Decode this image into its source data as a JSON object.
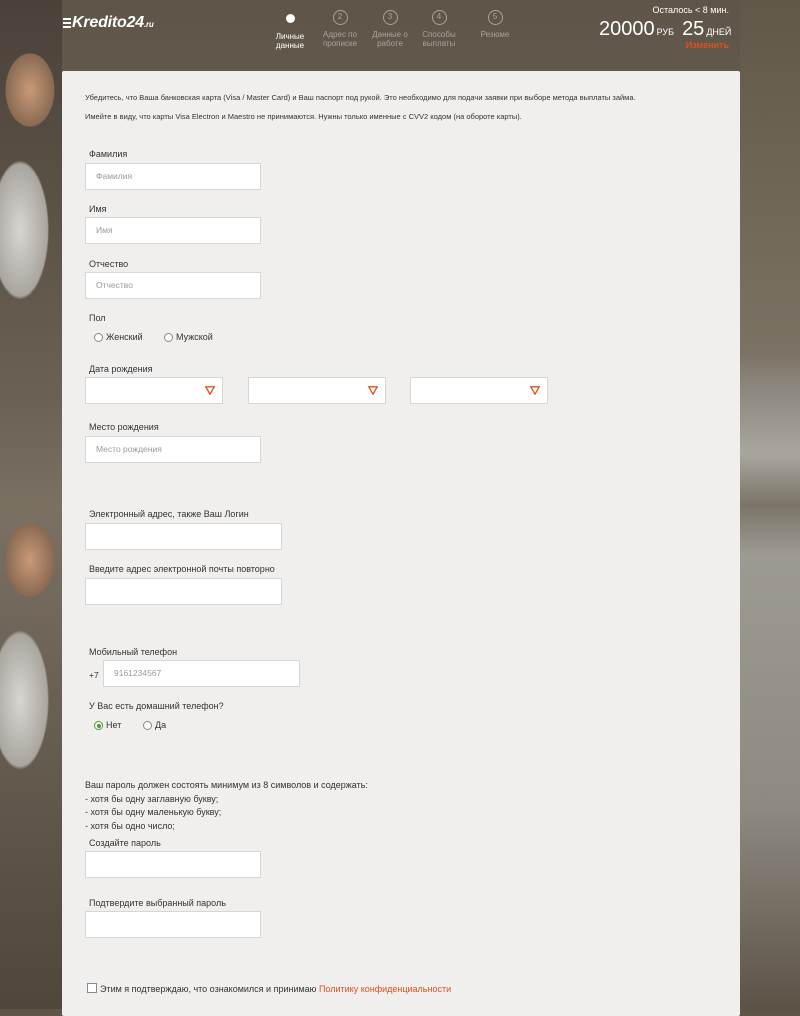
{
  "header": {
    "logo": "Kredito24",
    "logo_tld": ".ru",
    "steps": [
      {
        "num": "",
        "label1": "Личные",
        "label2": "данные",
        "active": true
      },
      {
        "num": "2",
        "label1": "Адрес по",
        "label2": "прописке",
        "active": false
      },
      {
        "num": "3",
        "label1": "Данные о",
        "label2": "работе",
        "active": false
      },
      {
        "num": "4",
        "label1": "Способы",
        "label2": "выплаты",
        "active": false
      },
      {
        "num": "5",
        "label1": "Резюме",
        "label2": "",
        "active": false
      }
    ],
    "timer": "Осталось < 8 мин.",
    "amount": "20000",
    "amount_unit": "РУБ",
    "days": "25",
    "days_unit": "ДНЕЙ",
    "change_link": "Изменить"
  },
  "form": {
    "note1": "Убедитесь, что Ваша банковская карта (Visa / Master Card) и Ваш паспорт под рукой. Это необходимо для подачи заявки при выборе метода выплаты займа.",
    "note2": "Имейте в виду, что карты Visa Electron и Maestro не принимаются. Нужны только именные с CVV2 кодом (на обороте карты).",
    "lastname_label": "Фамилия",
    "lastname_placeholder": "Фамилия",
    "firstname_label": "Имя",
    "firstname_placeholder": "Имя",
    "patronymic_label": "Отчество",
    "patronymic_placeholder": "Отчество",
    "gender_label": "Пол",
    "gender_female": "Женский",
    "gender_male": "Мужской",
    "dob_label": "Дата рождения",
    "birthplace_label": "Место рождения",
    "birthplace_placeholder": "Место рождения",
    "email_label": "Электронный адрес, также Ваш Логин",
    "email_repeat_label": "Введите адрес электронной почты повторно",
    "phone_label": "Мобильный телефон",
    "phone_prefix": "+7",
    "phone_placeholder": "9161234567",
    "home_phone_label": "У Вас есть домашний телефон?",
    "home_phone_no": "Нет",
    "home_phone_yes": "Да",
    "pw_rules": [
      "Ваш пароль должен состоять минимум из 8 символов и содержать:",
      "- хотя бы одну заглавную букву;",
      "- хотя бы одну маленькую букву;",
      "- хотя бы одно число;"
    ],
    "password_label": "Создайте пароль",
    "password_confirm_label": "Подтвердите выбранный пароль",
    "consent_text": "Этим я подтверждаю, что ознакомился и принимаю",
    "consent_link": "Политику конфиденциальности"
  },
  "colors": {
    "accent": "#e24e1f",
    "radio_on": "#4a9e2e"
  }
}
